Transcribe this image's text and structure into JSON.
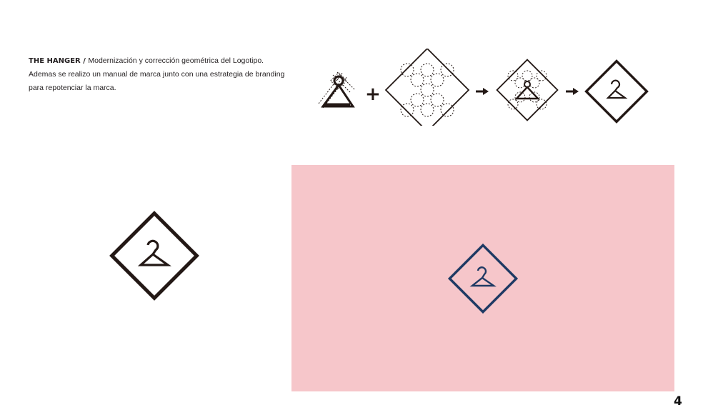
{
  "description": {
    "brand": "THE HANGER",
    "separator": " / ",
    "text": "Modernización y corrección geométrica del Logotipo. Ademas se realizo un manual de marca junto con una estrategia de branding para repotenciar la marca."
  },
  "process": {
    "plus_symbol": "+",
    "steps_icons": [
      "sketch-hanger-icon",
      "circle-grid-diamond-icon",
      "overlay-construction-icon",
      "final-logo-icon"
    ]
  },
  "colors": {
    "logo_dark": "#231815",
    "logo_navy": "#1f3a64",
    "panel_pink": "#f6c6ca",
    "text": "#231f20"
  },
  "page": {
    "number": "4"
  }
}
